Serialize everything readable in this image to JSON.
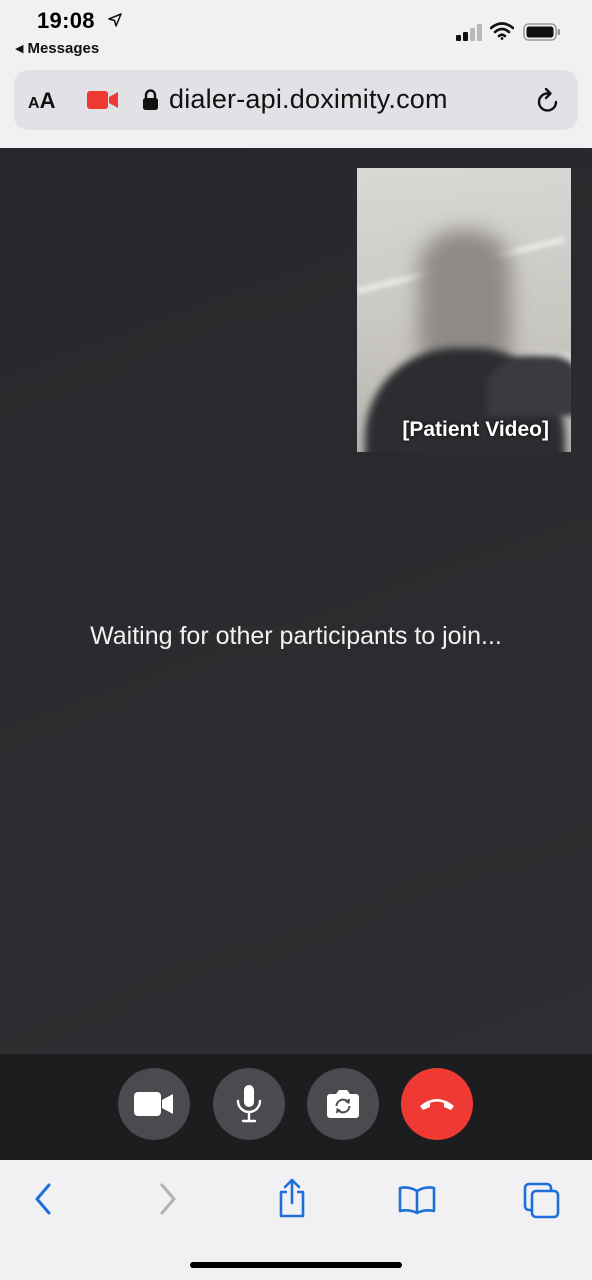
{
  "status_bar": {
    "time": "19:08",
    "back_app": "Messages",
    "icons": [
      "location-arrow-icon",
      "cellular-signal-icon",
      "wifi-icon",
      "battery-icon"
    ]
  },
  "address_bar": {
    "text_size_small": "A",
    "text_size_large": "A",
    "domain": "dialer-api.doximity.com",
    "icons": [
      "camera-recording-icon",
      "lock-icon",
      "reload-icon"
    ],
    "camera_recording_color": "#ee3a33"
  },
  "call": {
    "self_view_label": "[Patient Video]",
    "waiting_message": "Waiting for other participants to join..."
  },
  "controls": {
    "buttons": [
      "video-camera-icon",
      "microphone-icon",
      "switch-camera-icon",
      "end-call-icon"
    ],
    "end_call_color": "#ee3a33"
  },
  "toolbar": {
    "buttons": [
      "back-icon",
      "forward-icon",
      "share-icon",
      "bookmarks-icon",
      "tabs-icon"
    ],
    "accent": "#1e6fd9"
  }
}
